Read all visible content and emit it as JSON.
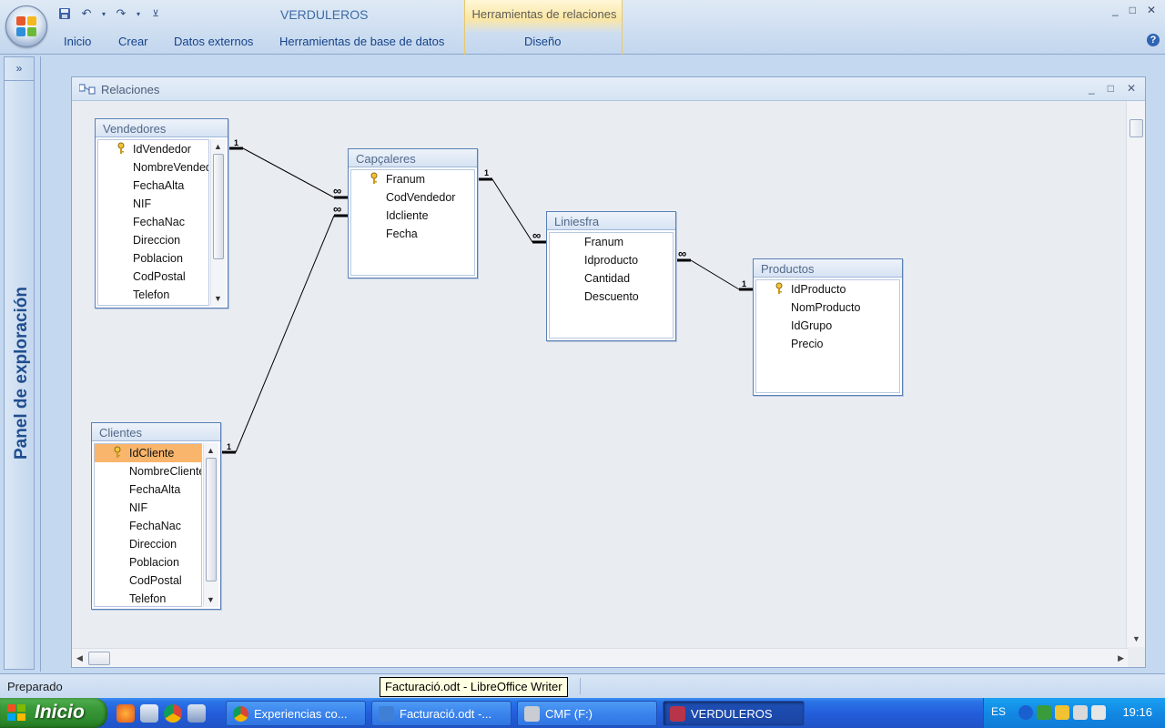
{
  "app": {
    "title": "VERDULEROS",
    "context_group": "Herramientas de relaciones",
    "window_controls": [
      "_",
      "□",
      "✕"
    ]
  },
  "ribbon": {
    "tabs": [
      "Inicio",
      "Crear",
      "Datos externos",
      "Herramientas de base de datos",
      "Diseño"
    ]
  },
  "nav_pane": {
    "label": "Panel de exploración",
    "expand_glyph": "»"
  },
  "relations_window": {
    "title": "Relaciones",
    "controls": [
      "_",
      "□",
      "✕"
    ]
  },
  "tables": {
    "vendedores": {
      "name": "Vendedores",
      "fields": [
        "IdVendedor",
        "NombreVendedor",
        "FechaAlta",
        "NIF",
        "FechaNac",
        "Direccion",
        "Poblacion",
        "CodPostal",
        "Telefon"
      ],
      "key": "IdVendedor"
    },
    "capcaleres": {
      "name": "Capçaleres",
      "fields": [
        "Franum",
        "CodVendedor",
        "Idcliente",
        "Fecha"
      ],
      "key": "Franum"
    },
    "liniesfra": {
      "name": "Liniesfra",
      "fields": [
        "Franum",
        "Idproducto",
        "Cantidad",
        "Descuento"
      ],
      "key": ""
    },
    "productos": {
      "name": "Productos",
      "fields": [
        "IdProducto",
        "NomProducto",
        "IdGrupo",
        "Precio"
      ],
      "key": "IdProducto"
    },
    "clientes": {
      "name": "Clientes",
      "fields": [
        "IdCliente",
        "NombreCliente",
        "FechaAlta",
        "NIF",
        "FechaNac",
        "Direccion",
        "Poblacion",
        "CodPostal",
        "Telefon"
      ],
      "key": "IdCliente",
      "selected": "IdCliente"
    }
  },
  "relationships": [
    {
      "from": "Vendedores.IdVendedor",
      "to": "Capçaleres.CodVendedor",
      "one": "1",
      "many": "∞"
    },
    {
      "from": "Clientes.IdCliente",
      "to": "Capçaleres.Idcliente",
      "one": "1",
      "many": "∞"
    },
    {
      "from": "Capçaleres.Franum",
      "to": "Liniesfra.Franum",
      "one": "1",
      "many": "∞"
    },
    {
      "from": "Productos.IdProducto",
      "to": "Liniesfra.Idproducto",
      "one": "1",
      "many": "∞"
    }
  ],
  "status": {
    "text": "Preparado",
    "tooltip": "Facturació.odt - LibreOffice Writer"
  },
  "taskbar": {
    "start_label": "Inicio",
    "tasks": [
      {
        "label": "Experiencias co...",
        "icon_color": "#e0453a",
        "active": false
      },
      {
        "label": "Facturació.odt -...",
        "icon_color": "#3f7fd6",
        "active": false
      },
      {
        "label": "CMF (F:)",
        "icon_color": "#c9ccd2",
        "active": false
      },
      {
        "label": "VERDULEROS",
        "icon_color": "#b8344a",
        "active": true
      }
    ],
    "lang": "ES",
    "clock": "19:16"
  },
  "colors": {
    "ribbon_bg": "#d2e1f2",
    "selected_field": "#f9b56b",
    "taskbar": "#245edb",
    "start_button": "#3c9b3a"
  }
}
